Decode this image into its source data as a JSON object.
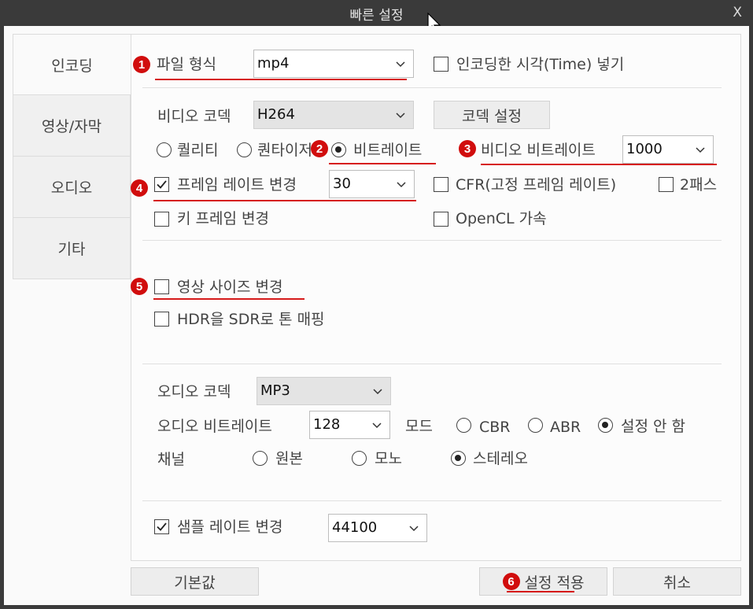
{
  "window": {
    "title": "빠른 설정",
    "close_label": "X"
  },
  "nav": {
    "items": [
      "인코딩",
      "영상/자막",
      "오디오",
      "기타"
    ],
    "active_index": 0
  },
  "video": {
    "file_format_label": "파일 형식",
    "file_format_value": "mp4",
    "insert_time_label": "인코딩한 시각(Time) 넣기",
    "codec_label": "비디오 코덱",
    "codec_value": "H264",
    "codec_settings_button": "코덱 설정",
    "rc_options": [
      "퀄리티",
      "퀀타이저",
      "비트레이트"
    ],
    "rc_selected_index": 2,
    "bitrate_label": "비디오 비트레이트",
    "bitrate_value": "1000",
    "framerate_change_label": "프레임 레이트 변경",
    "framerate_change_checked": true,
    "framerate_value": "30",
    "cfr_label": "CFR(고정 프레임 레이트)",
    "cfr_checked": false,
    "twopass_label": "2패스",
    "twopass_checked": false,
    "keyframe_label": "키 프레임 변경",
    "keyframe_checked": false,
    "opencl_label": "OpenCL 가속",
    "opencl_checked": false,
    "resize_label": "영상 사이즈 변경",
    "resize_checked": false,
    "hdr_label": "HDR을 SDR로 톤 매핑",
    "hdr_checked": false
  },
  "audio": {
    "codec_label": "오디오 코덱",
    "codec_value": "MP3",
    "bitrate_label": "오디오 비트레이트",
    "bitrate_value": "128",
    "mode_label": "모드",
    "mode_options": [
      "CBR",
      "ABR",
      "설정 안 함"
    ],
    "mode_selected_index": 2,
    "channel_label": "채널",
    "channel_options": [
      "원본",
      "모노",
      "스테레오"
    ],
    "channel_selected_index": 2,
    "samplerate_change_label": "샘플 레이트 변경",
    "samplerate_change_checked": true,
    "samplerate_value": "44100"
  },
  "footer": {
    "default_button": "기본값",
    "apply_button": "설정 적용",
    "cancel_button": "취소"
  },
  "annotations": {
    "badges": [
      "1",
      "2",
      "3",
      "4",
      "5",
      "6"
    ],
    "color": "#d10d0d"
  }
}
